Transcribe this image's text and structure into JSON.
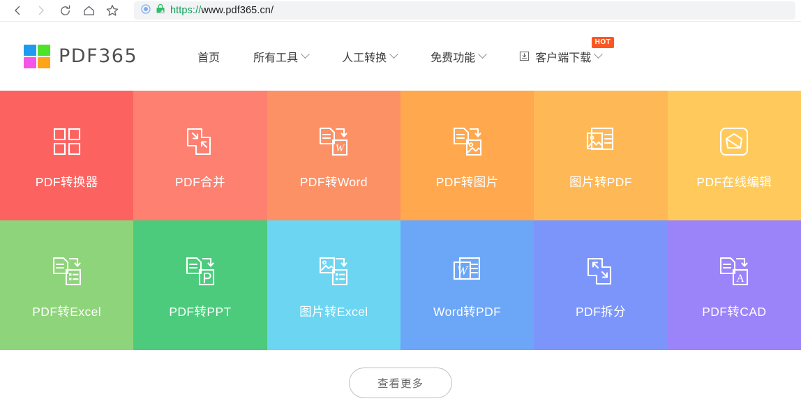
{
  "browser": {
    "back_icon": "back-arrow-icon",
    "forward_icon": "forward-arrow-icon",
    "reload_icon": "reload-icon",
    "home_icon": "home-icon",
    "bookmark_icon": "star-icon",
    "url_scheme": "https://",
    "url_host": "www.pdf365.cn/",
    "shield_icon": "shield-circle-icon",
    "lock_icon": "lock-warning-icon"
  },
  "site": {
    "logo_text": "PDF365",
    "logo_colors": {
      "top_left": "#1e9bf0",
      "top_right": "#4ce32a",
      "bottom_left": "#f455e8",
      "bottom_right": "#ffa319"
    },
    "nav": [
      {
        "label": "首页",
        "has_caret": false,
        "icon": null,
        "badge": null
      },
      {
        "label": "所有工具",
        "has_caret": true,
        "icon": null,
        "badge": null
      },
      {
        "label": "人工转换",
        "has_caret": true,
        "icon": null,
        "badge": null
      },
      {
        "label": "免费功能",
        "has_caret": true,
        "icon": null,
        "badge": null
      },
      {
        "label": "客户端下载",
        "has_caret": true,
        "icon": "download-icon",
        "badge": "HOT"
      }
    ]
  },
  "tiles": [
    {
      "label": "PDF转换器",
      "color": "#fc6360",
      "icon": "four-squares-grid-icon"
    },
    {
      "label": "PDF合并",
      "color": "#fd8070",
      "icon": "merge-documents-icon"
    },
    {
      "label": "PDF转Word",
      "color": "#fc9166",
      "icon": "doc-to-word-icon"
    },
    {
      "label": "PDF转图片",
      "color": "#ffa84e",
      "icon": "doc-to-image-icon"
    },
    {
      "label": "图片转PDF",
      "color": "#ffb856",
      "icon": "image-to-doc-icon"
    },
    {
      "label": "PDF在线编辑",
      "color": "#ffca5b",
      "icon": "edit-shape-icon"
    },
    {
      "label": "PDF转Excel",
      "color": "#8ed47a",
      "icon": "doc-to-excel-icon"
    },
    {
      "label": "PDF转PPT",
      "color": "#4ccb7c",
      "icon": "doc-to-ppt-icon"
    },
    {
      "label": "图片转Excel",
      "color": "#6bd5f2",
      "icon": "image-to-excel-icon"
    },
    {
      "label": "Word转PDF",
      "color": "#6ba6f7",
      "icon": "word-doc-icon"
    },
    {
      "label": "PDF拆分",
      "color": "#7b95fb",
      "icon": "split-documents-icon"
    },
    {
      "label": "PDF转CAD",
      "color": "#9b83f9",
      "icon": "doc-to-cad-icon"
    }
  ],
  "footer": {
    "more_label": "查看更多"
  }
}
